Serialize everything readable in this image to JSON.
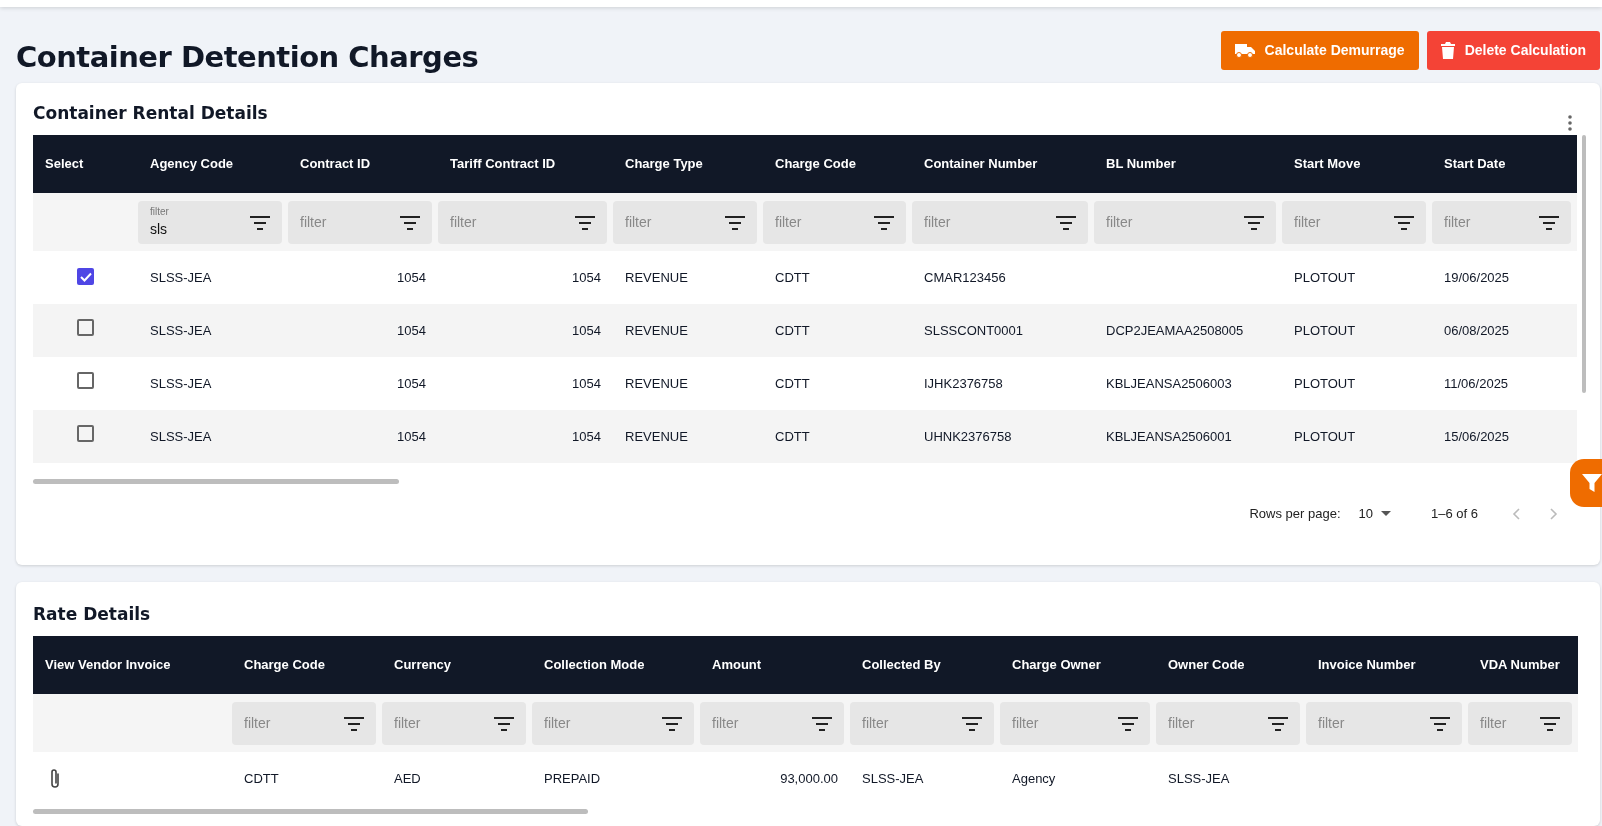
{
  "page": {
    "title": "Container Detention Charges"
  },
  "actions": [
    {
      "label": "Calculate Demurrage",
      "kind": "calculate"
    },
    {
      "label": "Delete Calculation",
      "kind": "delete"
    }
  ],
  "rental": {
    "title": "Container Rental Details",
    "columns": [
      {
        "label": "Select",
        "kind": "checkbox"
      },
      {
        "label": "Agency Code",
        "kind": "text",
        "filter": {
          "label": "filter",
          "value": "sls"
        }
      },
      {
        "label": "Contract ID",
        "kind": "number",
        "filter": {
          "placeholder": "filter"
        }
      },
      {
        "label": "Tariff Contract ID",
        "kind": "number",
        "filter": {
          "placeholder": "filter"
        }
      },
      {
        "label": "Charge Type",
        "kind": "text",
        "filter": {
          "placeholder": "filter"
        }
      },
      {
        "label": "Charge Code",
        "kind": "text",
        "filter": {
          "placeholder": "filter"
        }
      },
      {
        "label": "Container Number",
        "kind": "text",
        "filter": {
          "placeholder": "filter"
        }
      },
      {
        "label": "BL Number",
        "kind": "text",
        "filter": {
          "placeholder": "filter"
        }
      },
      {
        "label": "Start Move",
        "kind": "text",
        "filter": {
          "placeholder": "filter"
        }
      },
      {
        "label": "Start Date",
        "kind": "text",
        "filter": {
          "placeholder": "filter"
        }
      }
    ],
    "rows": [
      {
        "checked": true,
        "cells": [
          "",
          "SLSS-JEA",
          "1054",
          "1054",
          "REVENUE",
          "CDTT",
          "CMAR123456",
          "",
          "PLOTOUT",
          "19/06/2025"
        ]
      },
      {
        "checked": false,
        "cells": [
          "",
          "SLSS-JEA",
          "1054",
          "1054",
          "REVENUE",
          "CDTT",
          "SLSSCONT0001",
          "DCP2JEAMAA2508005",
          "PLOTOUT",
          "06/08/2025"
        ]
      },
      {
        "checked": false,
        "cells": [
          "",
          "SLSS-JEA",
          "1054",
          "1054",
          "REVENUE",
          "CDTT",
          "IJHK2376758",
          "KBLJEANSA2506003",
          "PLOTOUT",
          "11/06/2025"
        ]
      },
      {
        "checked": false,
        "cells": [
          "",
          "SLSS-JEA",
          "1054",
          "1054",
          "REVENUE",
          "CDTT",
          "UHNK2376758",
          "KBLJEANSA2506001",
          "PLOTOUT",
          "15/06/2025"
        ]
      }
    ],
    "pagination": {
      "rows_per_page_label": "Rows per page:",
      "rows_per_page": "10",
      "range": "1–6 of 6"
    }
  },
  "rates": {
    "title": "Rate Details",
    "columns": [
      {
        "label": "View Vendor Invoice",
        "kind": "attachment"
      },
      {
        "label": "Charge Code",
        "kind": "text",
        "filter": {
          "placeholder": "filter"
        }
      },
      {
        "label": "Currency",
        "kind": "text",
        "filter": {
          "placeholder": "filter"
        }
      },
      {
        "label": "Collection Mode",
        "kind": "text",
        "filter": {
          "placeholder": "filter"
        }
      },
      {
        "label": "Amount",
        "kind": "number",
        "filter": {
          "placeholder": "filter"
        }
      },
      {
        "label": "Collected By",
        "kind": "text",
        "filter": {
          "placeholder": "filter"
        }
      },
      {
        "label": "Charge Owner",
        "kind": "text",
        "filter": {
          "placeholder": "filter"
        }
      },
      {
        "label": "Owner Code",
        "kind": "text",
        "filter": {
          "placeholder": "filter"
        }
      },
      {
        "label": "Invoice Number",
        "kind": "text",
        "filter": {
          "placeholder": "filter"
        }
      },
      {
        "label": "VDA Number",
        "kind": "text",
        "filter": {
          "placeholder": "filter"
        }
      }
    ],
    "rows": [
      {
        "cells": [
          "",
          "CDTT",
          "AED",
          "PREPAID",
          "93,000.00",
          "SLSS-JEA",
          "Agency",
          "SLSS-JEA",
          "",
          ""
        ]
      }
    ]
  }
}
